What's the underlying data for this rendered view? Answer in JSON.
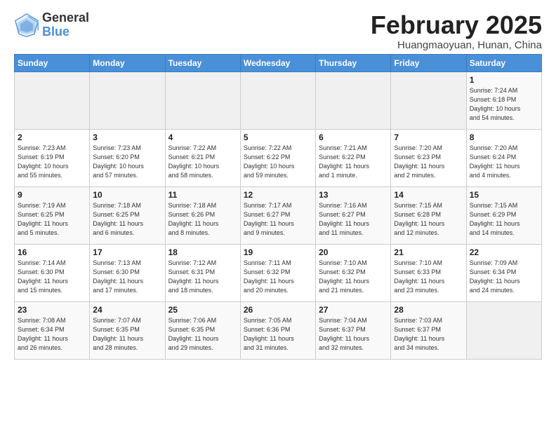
{
  "logo": {
    "line1": "General",
    "line2": "Blue"
  },
  "title": "February 2025",
  "subtitle": "Huangmaoyuan, Hunan, China",
  "days_of_week": [
    "Sunday",
    "Monday",
    "Tuesday",
    "Wednesday",
    "Thursday",
    "Friday",
    "Saturday"
  ],
  "weeks": [
    [
      {
        "num": "",
        "info": "",
        "empty": true
      },
      {
        "num": "",
        "info": "",
        "empty": true
      },
      {
        "num": "",
        "info": "",
        "empty": true
      },
      {
        "num": "",
        "info": "",
        "empty": true
      },
      {
        "num": "",
        "info": "",
        "empty": true
      },
      {
        "num": "",
        "info": "",
        "empty": true
      },
      {
        "num": "1",
        "info": "Sunrise: 7:24 AM\nSunset: 6:18 PM\nDaylight: 10 hours\nand 54 minutes."
      }
    ],
    [
      {
        "num": "2",
        "info": "Sunrise: 7:23 AM\nSunset: 6:19 PM\nDaylight: 10 hours\nand 55 minutes."
      },
      {
        "num": "3",
        "info": "Sunrise: 7:23 AM\nSunset: 6:20 PM\nDaylight: 10 hours\nand 57 minutes."
      },
      {
        "num": "4",
        "info": "Sunrise: 7:22 AM\nSunset: 6:21 PM\nDaylight: 10 hours\nand 58 minutes."
      },
      {
        "num": "5",
        "info": "Sunrise: 7:22 AM\nSunset: 6:22 PM\nDaylight: 10 hours\nand 59 minutes."
      },
      {
        "num": "6",
        "info": "Sunrise: 7:21 AM\nSunset: 6:22 PM\nDaylight: 11 hours\nand 1 minute."
      },
      {
        "num": "7",
        "info": "Sunrise: 7:20 AM\nSunset: 6:23 PM\nDaylight: 11 hours\nand 2 minutes."
      },
      {
        "num": "8",
        "info": "Sunrise: 7:20 AM\nSunset: 6:24 PM\nDaylight: 11 hours\nand 4 minutes."
      }
    ],
    [
      {
        "num": "9",
        "info": "Sunrise: 7:19 AM\nSunset: 6:25 PM\nDaylight: 11 hours\nand 5 minutes."
      },
      {
        "num": "10",
        "info": "Sunrise: 7:18 AM\nSunset: 6:25 PM\nDaylight: 11 hours\nand 6 minutes."
      },
      {
        "num": "11",
        "info": "Sunrise: 7:18 AM\nSunset: 6:26 PM\nDaylight: 11 hours\nand 8 minutes."
      },
      {
        "num": "12",
        "info": "Sunrise: 7:17 AM\nSunset: 6:27 PM\nDaylight: 11 hours\nand 9 minutes."
      },
      {
        "num": "13",
        "info": "Sunrise: 7:16 AM\nSunset: 6:27 PM\nDaylight: 11 hours\nand 11 minutes."
      },
      {
        "num": "14",
        "info": "Sunrise: 7:15 AM\nSunset: 6:28 PM\nDaylight: 11 hours\nand 12 minutes."
      },
      {
        "num": "15",
        "info": "Sunrise: 7:15 AM\nSunset: 6:29 PM\nDaylight: 11 hours\nand 14 minutes."
      }
    ],
    [
      {
        "num": "16",
        "info": "Sunrise: 7:14 AM\nSunset: 6:30 PM\nDaylight: 11 hours\nand 15 minutes."
      },
      {
        "num": "17",
        "info": "Sunrise: 7:13 AM\nSunset: 6:30 PM\nDaylight: 11 hours\nand 17 minutes."
      },
      {
        "num": "18",
        "info": "Sunrise: 7:12 AM\nSunset: 6:31 PM\nDaylight: 11 hours\nand 18 minutes."
      },
      {
        "num": "19",
        "info": "Sunrise: 7:11 AM\nSunset: 6:32 PM\nDaylight: 11 hours\nand 20 minutes."
      },
      {
        "num": "20",
        "info": "Sunrise: 7:10 AM\nSunset: 6:32 PM\nDaylight: 11 hours\nand 21 minutes."
      },
      {
        "num": "21",
        "info": "Sunrise: 7:10 AM\nSunset: 6:33 PM\nDaylight: 11 hours\nand 23 minutes."
      },
      {
        "num": "22",
        "info": "Sunrise: 7:09 AM\nSunset: 6:34 PM\nDaylight: 11 hours\nand 24 minutes."
      }
    ],
    [
      {
        "num": "23",
        "info": "Sunrise: 7:08 AM\nSunset: 6:34 PM\nDaylight: 11 hours\nand 26 minutes."
      },
      {
        "num": "24",
        "info": "Sunrise: 7:07 AM\nSunset: 6:35 PM\nDaylight: 11 hours\nand 28 minutes."
      },
      {
        "num": "25",
        "info": "Sunrise: 7:06 AM\nSunset: 6:35 PM\nDaylight: 11 hours\nand 29 minutes."
      },
      {
        "num": "26",
        "info": "Sunrise: 7:05 AM\nSunset: 6:36 PM\nDaylight: 11 hours\nand 31 minutes."
      },
      {
        "num": "27",
        "info": "Sunrise: 7:04 AM\nSunset: 6:37 PM\nDaylight: 11 hours\nand 32 minutes."
      },
      {
        "num": "28",
        "info": "Sunrise: 7:03 AM\nSunset: 6:37 PM\nDaylight: 11 hours\nand 34 minutes."
      },
      {
        "num": "",
        "info": "",
        "empty": true
      }
    ]
  ]
}
